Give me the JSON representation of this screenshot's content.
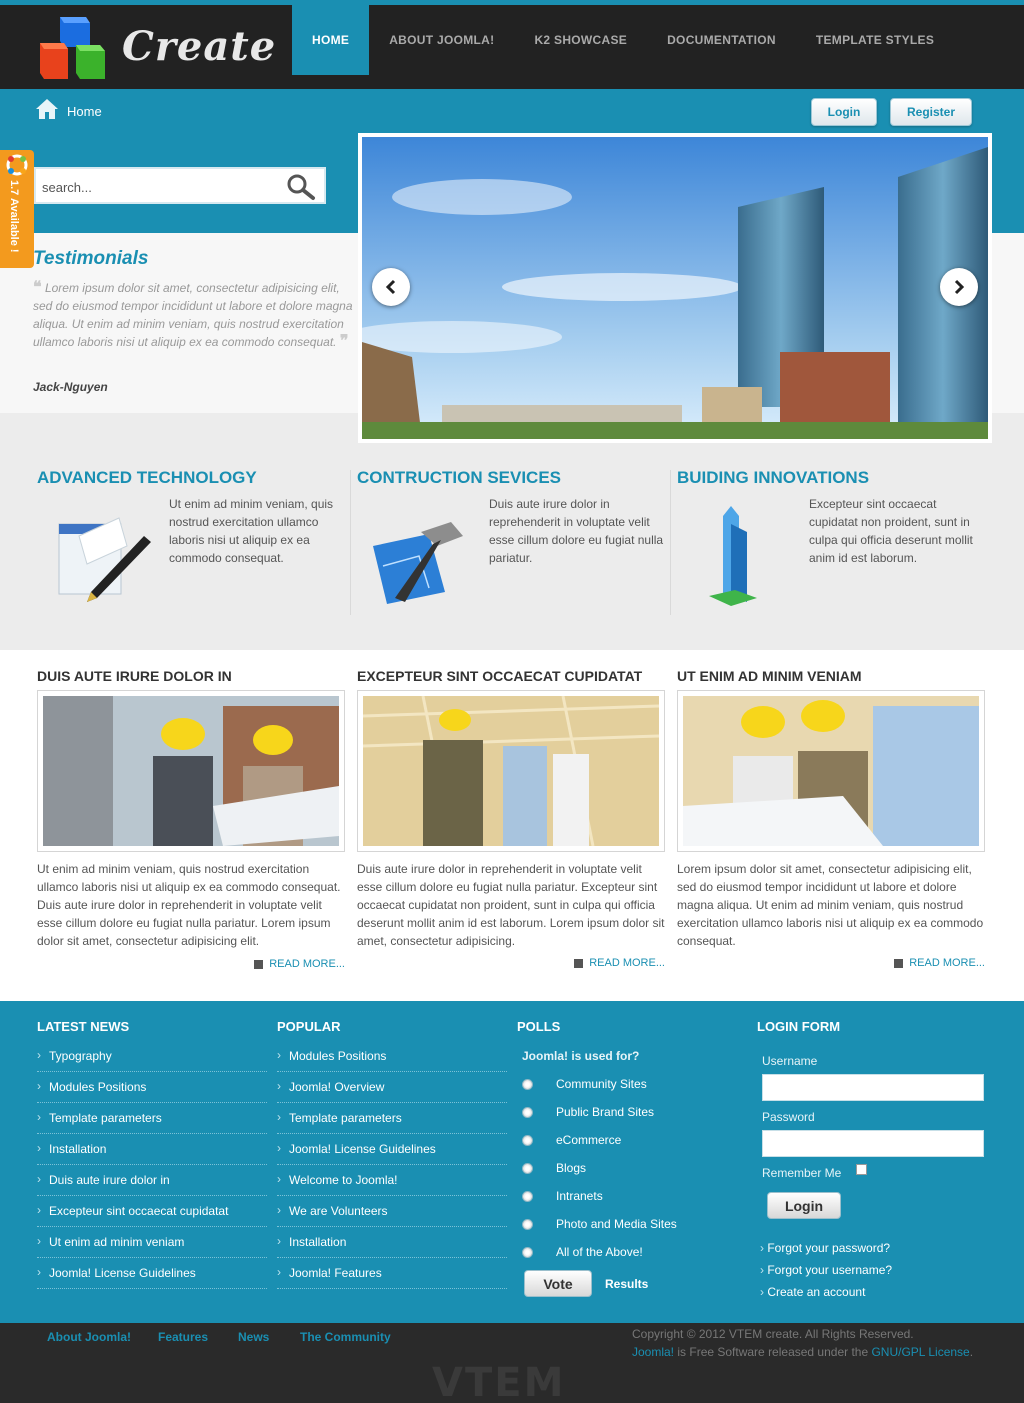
{
  "brand": {
    "name": "Create",
    "accent": "#1a8fb2",
    "header_bg": "#222222"
  },
  "nav": [
    {
      "label": "HOME",
      "active": true
    },
    {
      "label": "ABOUT JOOMLA!",
      "active": false
    },
    {
      "label": "K2 SHOWCASE",
      "active": false
    },
    {
      "label": "DOCUMENTATION",
      "active": false
    },
    {
      "label": "TEMPLATE STYLES",
      "active": false
    }
  ],
  "breadcrumb": {
    "home": "Home"
  },
  "auth": {
    "login": "Login",
    "register": "Register"
  },
  "side_tab": {
    "label": "1.7 Available !"
  },
  "search": {
    "placeholder": "search..."
  },
  "testimonials": {
    "title": "Testimonials",
    "text": "Lorem ipsum dolor sit amet, consectetur adipisicing elit, sed do eiusmod tempor incididunt ut labore et dolore magna aliqua. Ut enim ad minim veniam, quis nostrud exercitation ullamco laboris nisi ut aliquip ex ea commodo consequat.",
    "author": "Jack-Nguyen"
  },
  "features": [
    {
      "title": "ADVANCED TECHNOLOGY",
      "text": "Ut enim ad minim veniam, quis nostrud exercitation ullamco laboris nisi ut aliquip ex ea commodo consequat.",
      "icon": "document-pen-icon"
    },
    {
      "title": "CONTRUCTION SEVICES",
      "text": "Duis aute irure dolor in reprehenderit in voluptate velit esse cillum dolore eu fugiat nulla pariatur.",
      "icon": "hammer-blueprint-icon"
    },
    {
      "title": "BUIDING INNOVATIONS",
      "text": "Excepteur sint occaecat cupidatat non proident, sunt in culpa qui officia deserunt mollit anim id est laborum.",
      "icon": "building-icon"
    }
  ],
  "articles": [
    {
      "title": "DUIS AUTE IRURE DOLOR IN",
      "text": "Ut enim ad minim veniam, quis nostrud exercitation ullamco laboris nisi ut aliquip ex ea commodo consequat. Duis aute irure dolor in reprehenderit in voluptate velit esse cillum dolore eu fugiat nulla pariatur. Lorem ipsum dolor sit amet, consectetur adipisicing elit.",
      "read_more": "READ MORE..."
    },
    {
      "title": "EXCEPTEUR SINT OCCAECAT CUPIDATAT",
      "text": "Duis aute irure dolor in reprehenderit in voluptate velit esse cillum dolore eu fugiat nulla pariatur. Excepteur sint occaecat cupidatat non proident, sunt in culpa qui officia deserunt mollit anim id est laborum. Lorem ipsum dolor sit amet, consectetur adipisicing.",
      "read_more": "READ MORE..."
    },
    {
      "title": "UT ENIM AD MINIM VENIAM",
      "text": "Lorem ipsum dolor sit amet, consectetur adipisicing elit, sed do eiusmod tempor incididunt ut labore et dolore magna aliqua. Ut enim ad minim veniam, quis nostrud exercitation ullamco laboris nisi ut aliquip ex ea commodo consequat.",
      "read_more": "READ MORE..."
    }
  ],
  "latest_news": {
    "title": "LATEST NEWS",
    "items": [
      "Typography",
      "Modules Positions",
      "Template parameters",
      "Installation",
      "Duis aute irure dolor in",
      "Excepteur sint occaecat cupidatat",
      "Ut enim ad minim veniam",
      "Joomla! License Guidelines"
    ]
  },
  "popular": {
    "title": "POPULAR",
    "items": [
      "Modules Positions",
      "Joomla! Overview",
      "Template parameters",
      "Joomla! License Guidelines",
      "Welcome to Joomla!",
      "We are Volunteers",
      "Installation",
      "Joomla! Features"
    ]
  },
  "polls": {
    "title": "POLLS",
    "question": "Joomla! is used for?",
    "options": [
      "Community Sites",
      "Public Brand Sites",
      "eCommerce",
      "Blogs",
      "Intranets",
      "Photo and Media Sites",
      "All of the Above!"
    ],
    "vote": "Vote",
    "results": "Results"
  },
  "login_form": {
    "title": "LOGIN FORM",
    "username_label": "Username",
    "password_label": "Password",
    "remember_label": "Remember Me",
    "button": "Login",
    "links": [
      "Forgot your password?",
      "Forgot your username?",
      "Create an account"
    ]
  },
  "footer": {
    "links": [
      "About Joomla!",
      "Features",
      "News",
      "The Community"
    ],
    "copyright": "Copyright © 2012 VTEM create. All Rights Reserved.",
    "joomla_link": "Joomla!",
    "license_middle": " is Free Software released under the ",
    "license_link": "GNU/GPL License",
    "license_end": ".",
    "logo": "VTEM"
  }
}
